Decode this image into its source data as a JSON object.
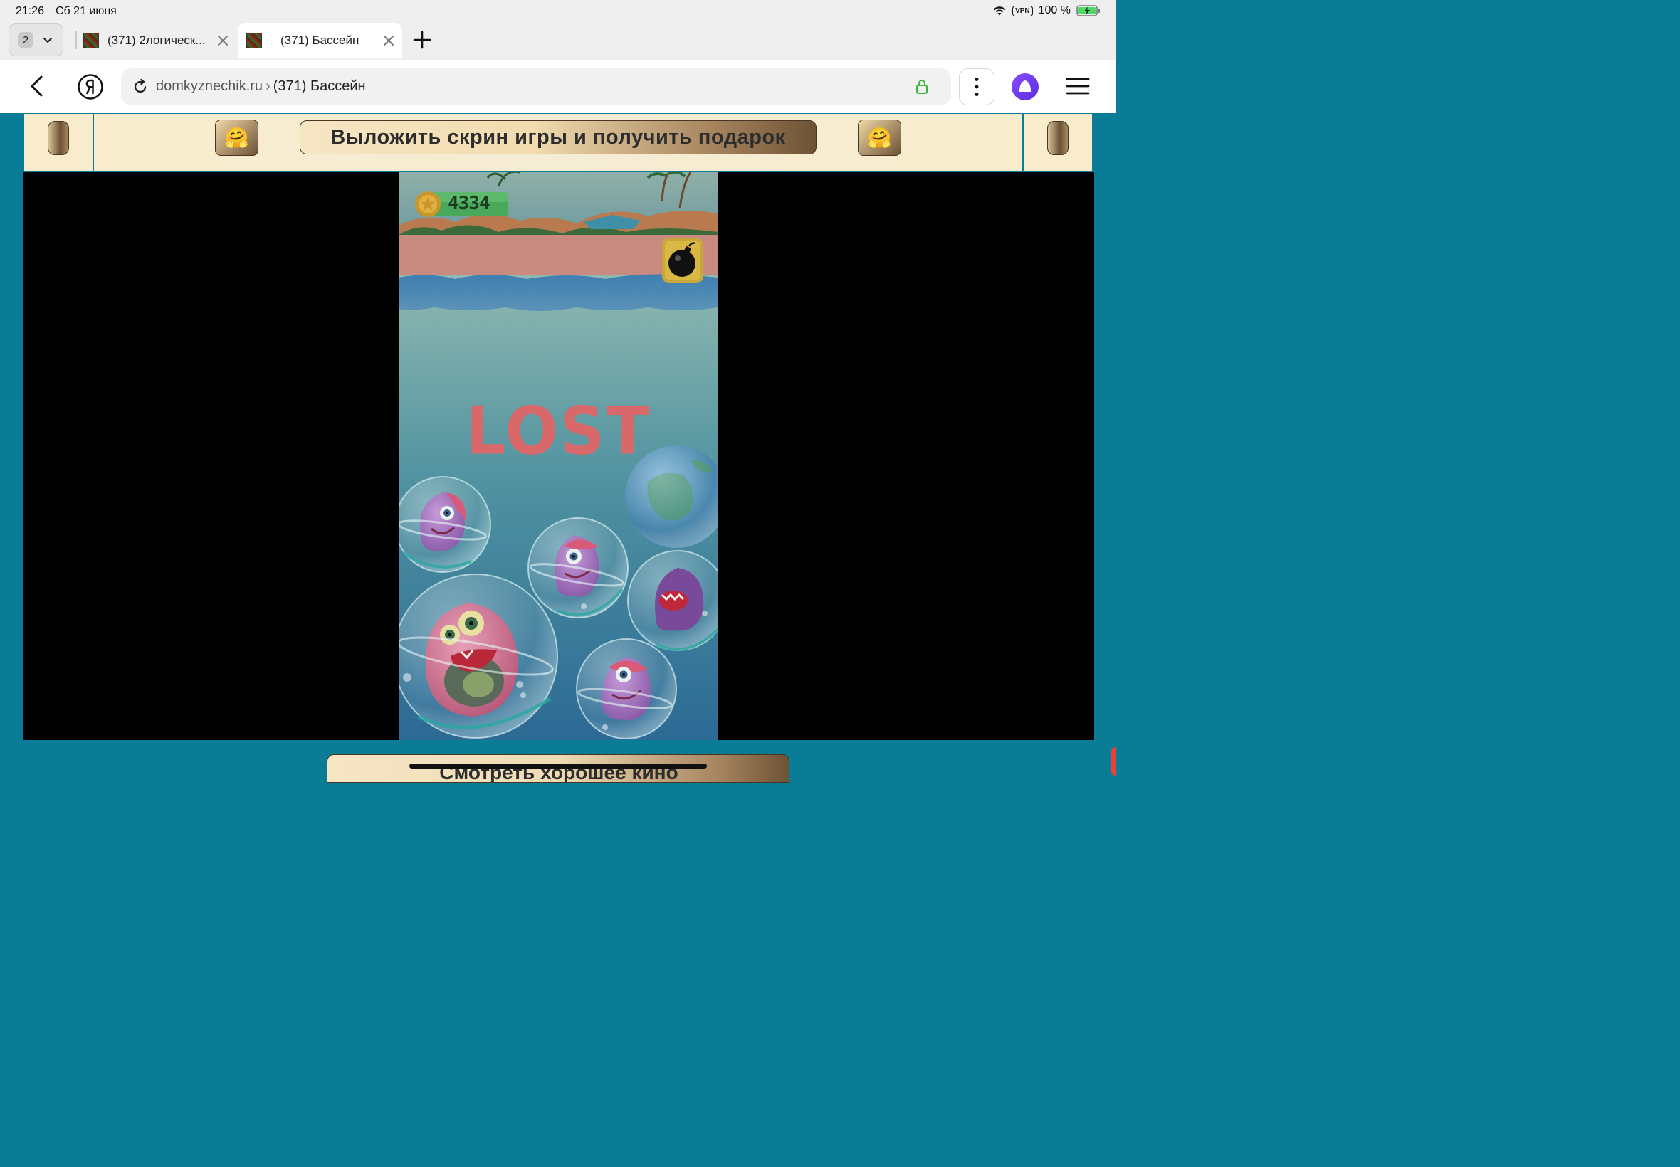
{
  "status_bar": {
    "time": "21:26",
    "date": "Сб 21 июня",
    "vpn": "VPN",
    "battery": "100 %"
  },
  "tabs": {
    "counter": "2",
    "items": [
      {
        "title": "(371) 2логическ..."
      },
      {
        "title": "(371) Бассейн",
        "active": true
      }
    ]
  },
  "address_bar": {
    "domain": "domkyznechik.ru",
    "separator": "›",
    "page_title": "(371) Бассейн"
  },
  "page": {
    "top_banner_text": "Выложить скрин игры и получить подарок",
    "emoji": "🤗",
    "bottom_banner_text": "Смотреть хорошее кино"
  },
  "game": {
    "score": "4334",
    "status": "LOST",
    "icons": [
      "coin-icon",
      "bomb-icon"
    ],
    "colors": {
      "lost_text": "#d9686a",
      "water_top": "#5a8fb8",
      "water_bottom": "#2c6a95"
    }
  }
}
